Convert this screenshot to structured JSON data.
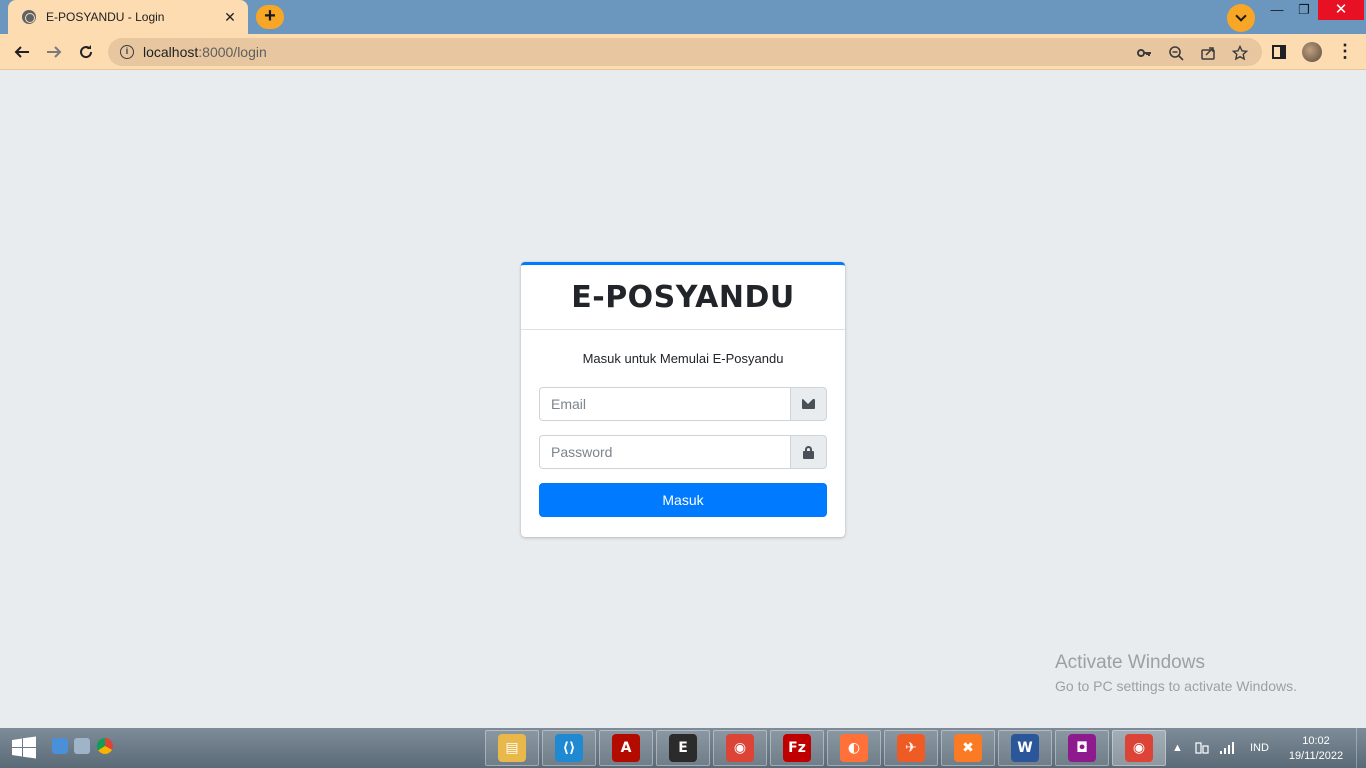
{
  "browser": {
    "tab_title": "E-POSYANDU - Login",
    "tab_close": "✕",
    "new_tab": "+",
    "url_host": "localhost",
    "url_rest": ":8000/login",
    "minimize": "—",
    "restore": "❐",
    "close": "✕",
    "accent_color": "#f7a625"
  },
  "login": {
    "brand": "E-POSYANDU",
    "message": "Masuk untuk Memulai E-Posyandu",
    "email_placeholder": "Email",
    "password_placeholder": "Password",
    "submit_label": "Masuk",
    "primary_color": "#007bff"
  },
  "watermark": {
    "line1": "Activate Windows",
    "line2": "Go to PC settings to activate Windows."
  },
  "taskbar": {
    "apps": [
      {
        "name": "file-explorer",
        "glyph": "▤",
        "color": "#e8b84a"
      },
      {
        "name": "vscode",
        "glyph": "⟨⟩",
        "color": "#1f8ad2"
      },
      {
        "name": "acrobat-reader",
        "glyph": "A",
        "color": "#b30b00"
      },
      {
        "name": "app-circle-e",
        "glyph": "E",
        "color": "#2b2b2b"
      },
      {
        "name": "chrome",
        "glyph": "◉",
        "color": "#db4437"
      },
      {
        "name": "filezilla",
        "glyph": "Fz",
        "color": "#bf0000"
      },
      {
        "name": "firefox",
        "glyph": "◐",
        "color": "#ff7139"
      },
      {
        "name": "postman",
        "glyph": "✈",
        "color": "#ef5b25"
      },
      {
        "name": "xampp",
        "glyph": "✖",
        "color": "#fb7a24"
      },
      {
        "name": "word",
        "glyph": "W",
        "color": "#2b579a"
      },
      {
        "name": "camera",
        "glyph": "◘",
        "color": "#8e1b8e"
      },
      {
        "name": "chrome-active",
        "glyph": "◉",
        "color": "#db4437"
      }
    ],
    "language": "IND",
    "time": "10:02",
    "date": "19/11/2022"
  }
}
